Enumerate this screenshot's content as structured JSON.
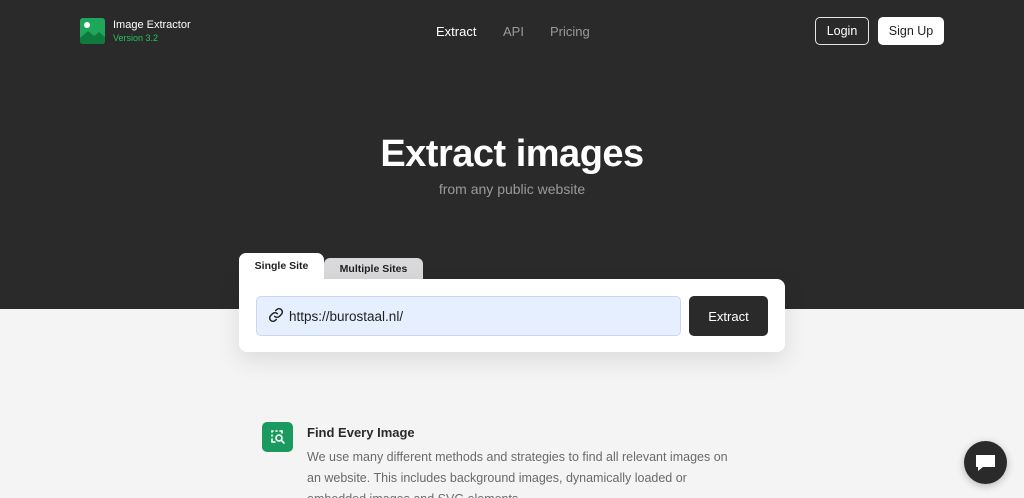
{
  "header": {
    "brand_name": "Image Extractor",
    "brand_version": "Version 3.2",
    "logo_icon": "image-icon",
    "nav": [
      {
        "label": "Extract",
        "active": true
      },
      {
        "label": "API",
        "active": false
      },
      {
        "label": "Pricing",
        "active": false
      }
    ],
    "login_label": "Login",
    "signup_label": "Sign Up"
  },
  "hero": {
    "title": "Extract images",
    "subtitle": "from any public website"
  },
  "extractor": {
    "tabs": [
      {
        "label": "Single Site",
        "active": true
      },
      {
        "label": "Multiple Sites",
        "active": false
      }
    ],
    "url_value": "https://burostaal.nl/",
    "link_icon": "link-icon",
    "extract_label": "Extract"
  },
  "features": [
    {
      "icon": "image-search-icon",
      "title": "Find Every Image",
      "description": "We use many different methods and strategies to find all relevant images on an website. This includes background images, dynamically loaded or embedded images and SVG elements."
    }
  ],
  "chat": {
    "icon": "chat-icon"
  },
  "colors": {
    "hero_bg": "#2a2a2b",
    "accent_green": "#1ea65a",
    "version_green": "#22c55e",
    "input_bg": "#e6efff"
  }
}
